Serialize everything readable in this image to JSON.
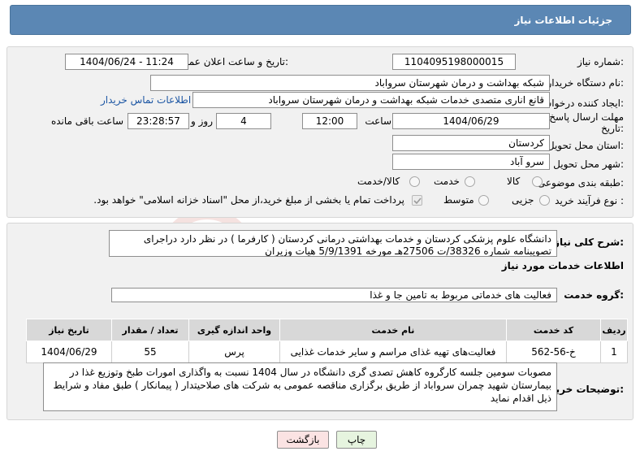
{
  "header": {
    "title": "جزئیات اطلاعات نیاز"
  },
  "details": {
    "need_number_label": "شماره نیاز:",
    "need_number": "1104095198000015",
    "announce_label": "تاریخ و ساعت اعلان عمومی:",
    "announce_value": "1404/06/24 - 11:24",
    "buyer_org_label": "نام دستگاه خریدار:",
    "buyer_org": "شبکه بهداشت و درمان شهرستان سرواباد",
    "creator_label": "ایجاد کننده درخواست:",
    "creator": "قانع اناری متصدی خدمات شبکه بهداشت و درمان شهرستان سرواباد",
    "contact_link": "اطلاعات تماس خریدار",
    "deadline_label_1": "مهلت ارسال پاسخ: تا",
    "deadline_label_2": "تاریخ:",
    "deadline_date": "1404/06/29",
    "time_label": "ساعت",
    "deadline_time": "12:00",
    "days_value": "4",
    "days_label": "روز و",
    "remaining_time": "23:28:57",
    "remaining_label": "ساعت باقی مانده",
    "province_label": "استان محل تحویل:",
    "province": "کردستان",
    "city_label": "شهر محل تحویل:",
    "city": "سرو آباد",
    "category_label": "طبقه بندی موضوعی:",
    "category_options": [
      "کالا",
      "خدمت",
      "کالا/خدمت"
    ],
    "process_label": "نوع فرآیند خرید :",
    "process_options": [
      "جزیی",
      "متوسط"
    ],
    "payment_note": "پرداخت تمام یا بخشی از مبلغ خرید،از محل \"اسناد خزانه اسلامی\" خواهد بود."
  },
  "summary": {
    "label": "شرح کلی نیاز:",
    "text": "دانشگاه علوم پزشکی کردستان و خدمات بهداشتی درمانی کردستان ( کارفرما ) در نظر دارد دراجرای تصویبنامه شماره 38326/ت 27506هـ مورخه 5/9/1391 هیات وزیران"
  },
  "services": {
    "section_title": "اطلاعات خدمات مورد نیاز",
    "group_label": "گروه خدمت:",
    "group_value": "فعالیت های خدماتی مربوط به تامین جا و غذا",
    "columns": [
      "ردیف",
      "کد خدمت",
      "نام خدمت",
      "واحد اندازه گیری",
      "تعداد / مقدار",
      "تاریخ نیاز"
    ],
    "rows": [
      {
        "row": "1",
        "code": "خ-56-562",
        "name": "فعالیت‌های تهیه غذای مراسم و سایر خدمات غذایی",
        "unit": "پرس",
        "qty": "55",
        "date": "1404/06/29"
      }
    ]
  },
  "buyer_notes": {
    "label": "توضیحات خریدار:",
    "text": "مصوبات سومین جلسه کارگروه کاهش تصدی گری دانشگاه در سال 1404 نسبت به واگذاری امورات طبخ وتوزیع غذا در بیمارستان شهید چمران سرواباد  از طریق برگزاری مناقصه عمومی به شرکت های صلاحیتدار ( پیمانکار ) طبق مفاد و شرایط ذیل اقدام نماید"
  },
  "buttons": {
    "print": "چاپ",
    "back": "بازگشت"
  },
  "colors": {
    "header": "#5b87b4",
    "card": "#f1f1f1",
    "back_button": "#fbe3e3",
    "print_button": "#e6f4df"
  }
}
